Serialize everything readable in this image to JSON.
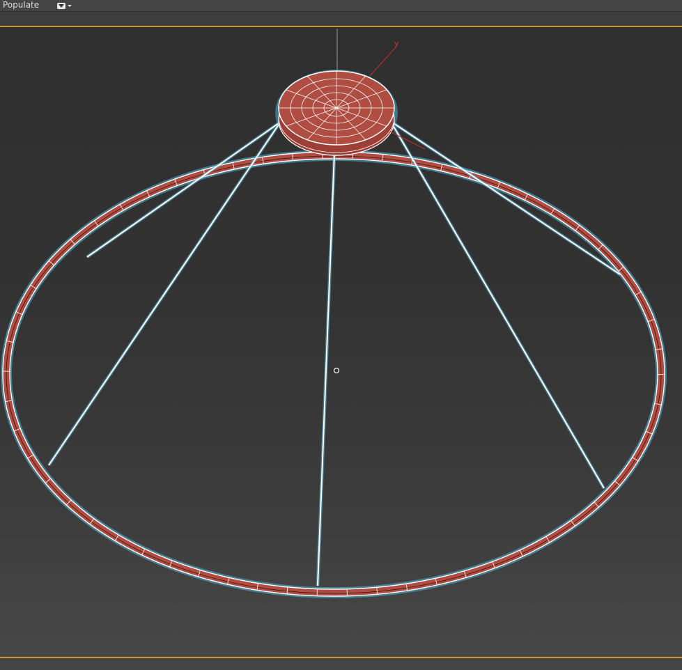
{
  "toolbar": {
    "populate_label": "Populate",
    "dropdown_icon": "dropdown-icon"
  },
  "viewport": {
    "active_border_color": "#c7962e",
    "gizmo_axis_label": "y",
    "object_color": "#b04d42",
    "wire_color": "#ffffff",
    "selection_glow_color": "#4fb6d9"
  }
}
